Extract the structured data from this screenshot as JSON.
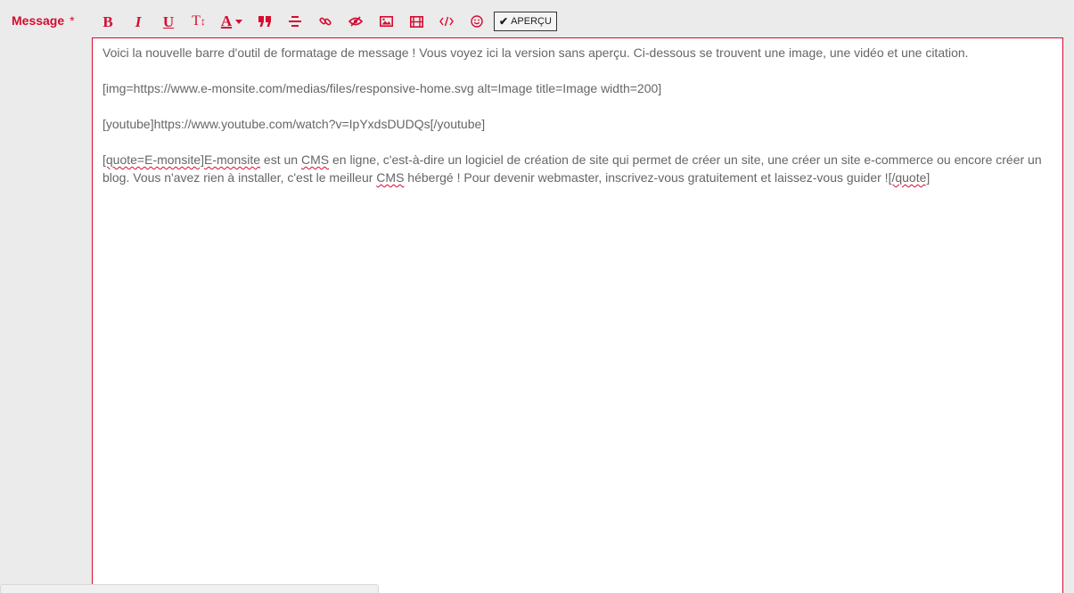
{
  "field": {
    "label": "Message",
    "required_mark": "*"
  },
  "toolbar": {
    "bold_label": "B",
    "italic_label": "I",
    "underline_label": "U",
    "size_label": "T↕",
    "color_label": "A",
    "preview_label": "APERÇU",
    "icons": [
      "bold-icon",
      "italic-icon",
      "underline-icon",
      "text-size-icon",
      "text-color-icon",
      "quote-icon",
      "align-center-icon",
      "link-icon",
      "spoiler-icon",
      "image-icon",
      "video-icon",
      "code-icon",
      "smiley-icon",
      "check-icon"
    ]
  },
  "colors": {
    "accent": "#d50c32",
    "text": "#666666",
    "background": "#ebebeb"
  },
  "editor": {
    "line1": "Voici la nouvelle barre d'outil de formatage de message ! Vous voyez ici la version sans aperçu. Ci-dessous se trouvent une image, une vidéo et une citation.",
    "line2": "[img=https://www.e-monsite.com/medias/files/responsive-home.svg alt=Image title=Image width=200]",
    "line3": "[youtube]https://www.youtube.com/watch?v=IpYxdsDUDQs[/youtube]",
    "quote_open": "[quote=E-monsite]",
    "quote_brand": "E-monsite",
    "quote_part1": " est un ",
    "quote_cms1": "CMS",
    "quote_part2": " en ligne, c'est-à-dire un logiciel de création de site qui permet de créer un site, une créer un site e-commerce ou encore créer un blog. Vous n'avez rien à installer, c'est le meilleur ",
    "quote_cms2": "CMS",
    "quote_part3": " hébergé ! Pour devenir webmaster, inscrivez-vous gratuitement et laissez-vous guider !",
    "quote_close": "[/quote]"
  }
}
